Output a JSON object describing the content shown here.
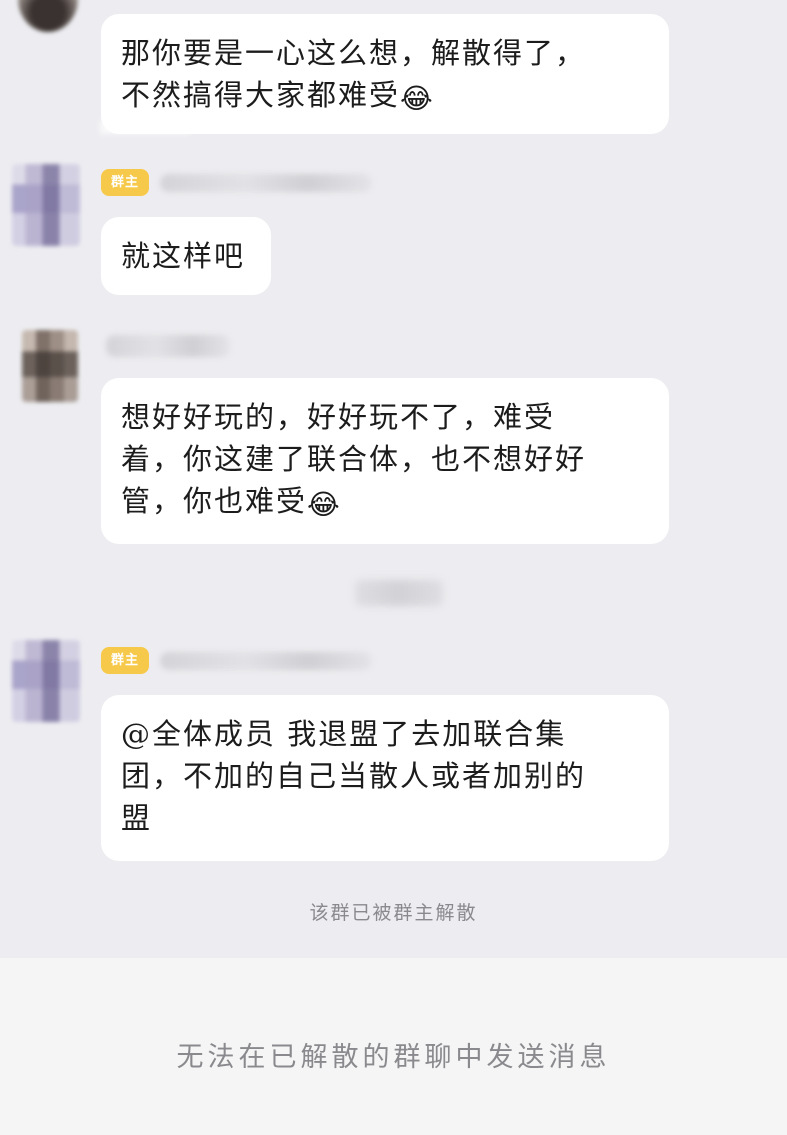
{
  "messages": [
    {
      "id": "m1",
      "lines": [
        "那你要是一心这么想，解散得了，",
        "不然搞得大家都难受"
      ],
      "trailing_emoji": "😂",
      "has_owner_badge": false
    },
    {
      "id": "m2",
      "lines": [
        "就这样吧"
      ],
      "trailing_emoji": "",
      "has_owner_badge": true
    },
    {
      "id": "m3",
      "lines": [
        "想好好玩的，好好玩不了，难受",
        "着，你这建了联合体，也不想好好",
        "管，你也难受"
      ],
      "trailing_emoji": "😂",
      "has_owner_badge": false
    },
    {
      "id": "m4",
      "lines": [
        "@全体成员 我退盟了去加联合集",
        "团，不加的自己当散人或者加别的",
        "盟"
      ],
      "trailing_emoji": "",
      "has_owner_badge": true
    }
  ],
  "owner_badge_label": "群主",
  "emoji_name": "face-with-tears-of-joy",
  "system_notice": "该群已被群主解散",
  "input_disabled_hint": "无法在已解散的群聊中发送消息",
  "colors": {
    "chat_background": "#ededf1",
    "bubble": "#ffffff",
    "owner_badge": "#f7c94a",
    "muted_text": "#8a8a8e",
    "input_area": "#f5f5f5"
  }
}
